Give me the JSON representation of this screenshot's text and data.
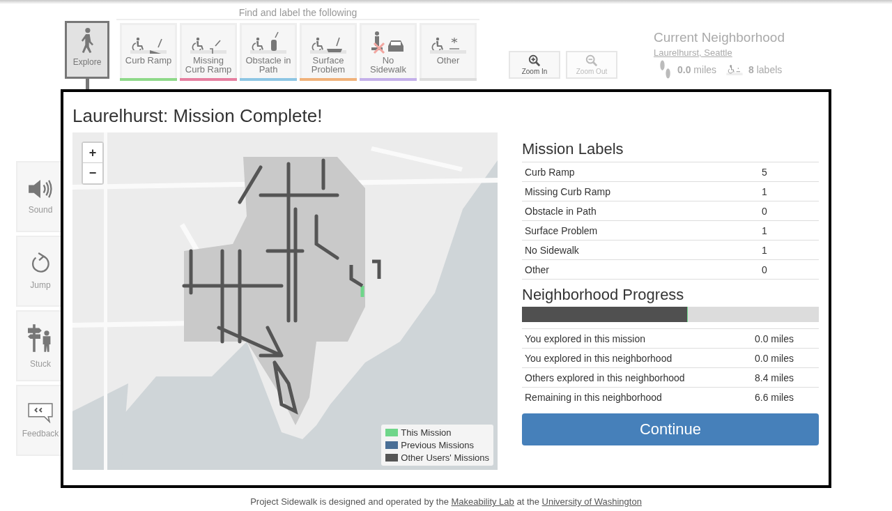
{
  "toolbar": {
    "explore": {
      "label": "Explore",
      "selected": true
    },
    "heading": "Find and label the following",
    "label_types": [
      {
        "kind": "curb_ramp",
        "label": "Curb Ramp",
        "color": "#8fd98a"
      },
      {
        "kind": "missing_curb_ramp",
        "label": "Missing Curb Ramp",
        "color": "#e67fa0"
      },
      {
        "kind": "obstacle",
        "label": "Obstacle in Path",
        "color": "#8ec6e4"
      },
      {
        "kind": "surface",
        "label": "Surface Problem",
        "color": "#f0b27a"
      },
      {
        "kind": "no_sidewalk",
        "label": "No Sidewalk",
        "color": "#c4b0ea"
      },
      {
        "kind": "other",
        "label": "Other",
        "color": "#dddddd"
      }
    ]
  },
  "zoom": [
    {
      "kind": "in",
      "label": "Zoom In",
      "disabled": false
    },
    {
      "kind": "out",
      "label": "Zoom Out",
      "disabled": true
    }
  ],
  "neighborhood": {
    "title": "Current Neighborhood",
    "name": "Laurelhurst, Seattle",
    "distance": "**0.0** miles",
    "labels": "**8** labels"
  },
  "side_buttons": [
    {
      "kind": "sound",
      "label": "Sound"
    },
    {
      "kind": "jump",
      "label": "Jump"
    },
    {
      "kind": "stuck",
      "label": "Stuck"
    },
    {
      "kind": "feedback",
      "label": "Feedback"
    }
  ],
  "modal": {
    "title": "Laurelhurst: Mission Complete!",
    "map": {
      "zoom_in": "+",
      "zoom_out": "−",
      "legend": [
        {
          "label": "This Mission",
          "color": "#6fd68a"
        },
        {
          "label": "Previous Missions",
          "color": "#4a6f96"
        },
        {
          "label": "Other Users' Missions",
          "color": "#555555"
        }
      ]
    },
    "labels_heading": "Mission Labels",
    "label_counts": [
      {
        "name": "Curb Ramp",
        "count": "5"
      },
      {
        "name": "Missing Curb Ramp",
        "count": "1"
      },
      {
        "name": "Obstacle in Path",
        "count": "0"
      },
      {
        "name": "Surface Problem",
        "count": "1"
      },
      {
        "name": "No Sidewalk",
        "count": "1"
      },
      {
        "name": "Other",
        "count": "0"
      }
    ],
    "progress_heading": "Neighborhood Progress",
    "progress": [
      {
        "level": 0.556,
        "color": "#505050"
      },
      {
        "level": 0.003,
        "color": "#6fd68a"
      }
    ],
    "stats": [
      {
        "name": "You explored in this mission",
        "value": "0.0 miles"
      },
      {
        "name": "You explored in this neighborhood",
        "value": "0.0 miles"
      },
      {
        "name": "Others explored in this neighborhood",
        "value": "8.4 miles"
      },
      {
        "name": "Remaining in this neighborhood",
        "value": "6.6 miles"
      }
    ],
    "continue": "Continue"
  },
  "footer": [
    {
      "kind": "text",
      "text": "Project Sidewalk is designed and operated by the "
    },
    {
      "kind": "link",
      "text": "Makeability Lab"
    },
    {
      "kind": "text",
      "text": " at the "
    },
    {
      "kind": "link",
      "text": "University of Washington"
    }
  ]
}
